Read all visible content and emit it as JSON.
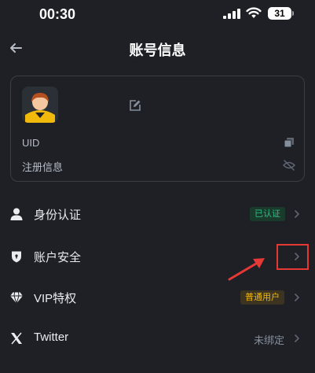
{
  "status_bar": {
    "time": "00:30",
    "battery": "31"
  },
  "header": {
    "title": "账号信息"
  },
  "account_card": {
    "uid_label": "UID",
    "registration_label": "注册信息"
  },
  "menu": {
    "identity": {
      "label": "身份认证",
      "badge": "已认证"
    },
    "security": {
      "label": "账户安全"
    },
    "vip": {
      "label": "VIP特权",
      "badge": "普通用户"
    },
    "twitter": {
      "label": "Twitter",
      "status": "未绑定"
    }
  },
  "colors": {
    "background": "#1e2026",
    "verified_green": "#2ebd85",
    "vip_yellow": "#f0b90b",
    "annotation_red": "#e53935"
  },
  "icons": [
    "signal-icon",
    "wifi-icon",
    "back-arrow-icon",
    "edit-icon",
    "copy-icon",
    "eye-off-icon",
    "person-icon",
    "shield-icon",
    "diamond-icon",
    "x-logo-icon",
    "chevron-right-icon"
  ]
}
